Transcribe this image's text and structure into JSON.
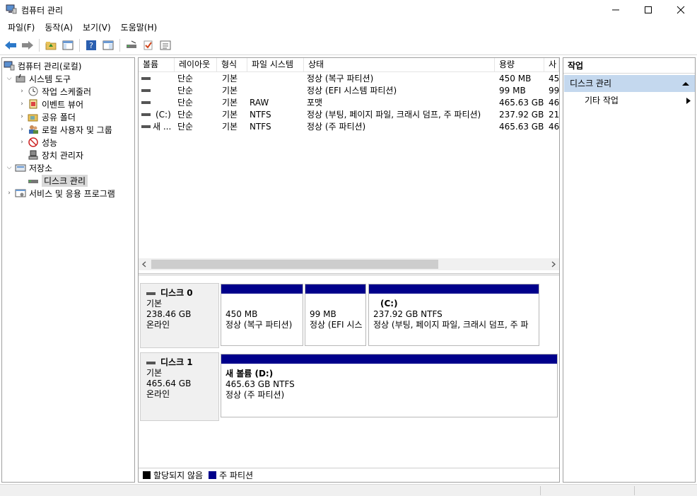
{
  "window": {
    "title": "컴퓨터 관리"
  },
  "menu": [
    "파일(F)",
    "동작(A)",
    "보기(V)",
    "도움말(H)"
  ],
  "tree": {
    "root": "컴퓨터 관리(로컬)",
    "system_tools": "시스템 도구",
    "task_scheduler": "작업 스케줄러",
    "event_viewer": "이벤트 뷰어",
    "shared_folders": "공유 폴더",
    "local_users": "로컬 사용자 및 그룹",
    "performance": "성능",
    "device_manager": "장치 관리자",
    "storage": "저장소",
    "disk_management": "디스크 관리",
    "services": "서비스 및 응용 프로그램"
  },
  "volume_table": {
    "headers": [
      "볼륨",
      "레이아웃",
      "형식",
      "파일 시스템",
      "상태",
      "용량",
      "사"
    ],
    "rows": [
      {
        "volume": "",
        "layout": "단순",
        "type": "기본",
        "fs": "",
        "status": "정상 (복구 파티션)",
        "capacity": "450 MB",
        "free": "45"
      },
      {
        "volume": "",
        "layout": "단순",
        "type": "기본",
        "fs": "",
        "status": "정상 (EFI 시스템 파티션)",
        "capacity": "99 MB",
        "free": "99"
      },
      {
        "volume": "",
        "layout": "단순",
        "type": "기본",
        "fs": "RAW",
        "status": "포맷",
        "capacity": "465.63 GB",
        "free": "46"
      },
      {
        "volume": "(C:)",
        "layout": "단순",
        "type": "기본",
        "fs": "NTFS",
        "status": "정상 (부팅, 페이지 파일, 크래시 덤프, 주 파티션)",
        "capacity": "237.92 GB",
        "free": "21"
      },
      {
        "volume": "새 ...",
        "layout": "단순",
        "type": "기본",
        "fs": "NTFS",
        "status": "정상 (주 파티션)",
        "capacity": "465.63 GB",
        "free": "46"
      }
    ]
  },
  "disks": [
    {
      "name": "디스크 0",
      "kind": "기본",
      "size": "238.46 GB",
      "state": "온라인",
      "partitions": [
        {
          "title": "",
          "line1": "450 MB",
          "line2": "정상 (복구 파티션)"
        },
        {
          "title": "",
          "line1": "99 MB",
          "line2": "정상 (EFI 시스"
        },
        {
          "title": "(C:)",
          "line1": "237.92 GB NTFS",
          "line2": "정상 (부팅, 페이지 파일, 크래시 덤프, 주 파"
        }
      ]
    },
    {
      "name": "디스크 1",
      "kind": "기본",
      "size": "465.64 GB",
      "state": "온라인",
      "partitions": [
        {
          "title": "새 볼륨  (D:)",
          "line1": "465.63 GB NTFS",
          "line2": "정상 (주 파티션)"
        }
      ]
    }
  ],
  "legend": {
    "unallocated": "할당되지 않음",
    "primary": "주 파티션"
  },
  "actions": {
    "header": "작업",
    "selected": "디스크 관리",
    "more": "기타 작업"
  },
  "colors": {
    "partition_bar": "#00008b",
    "unallocated": "#000000",
    "action_selected": "#c4d8ee"
  }
}
